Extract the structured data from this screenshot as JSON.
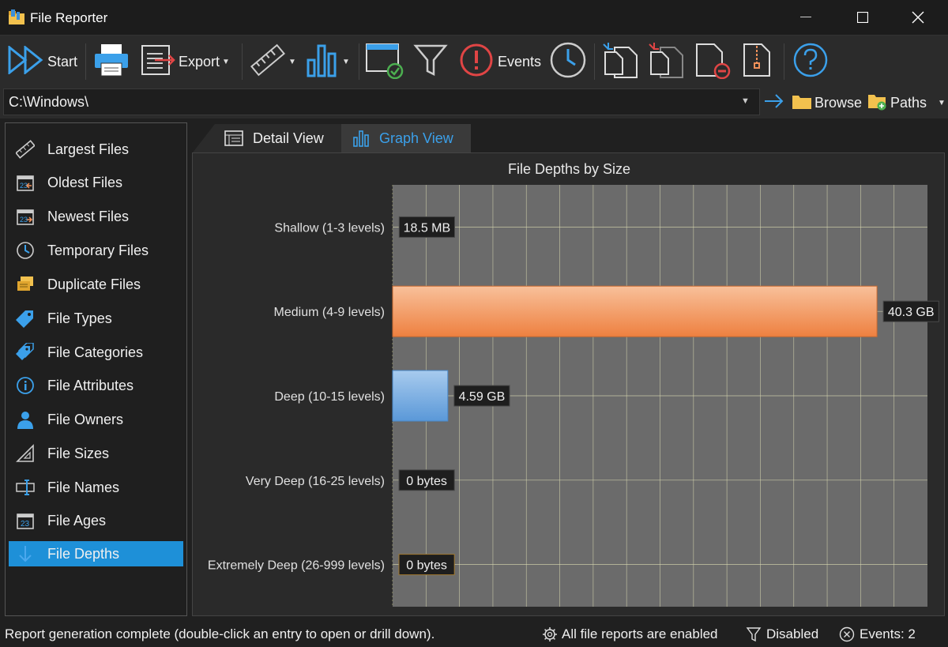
{
  "window": {
    "title": "File Reporter"
  },
  "toolbar": {
    "start_label": "Start",
    "export_label": "Export",
    "events_label": "Events"
  },
  "pathbar": {
    "path_value": "C:\\Windows\\",
    "browse_label": "Browse",
    "paths_label": "Paths"
  },
  "sidebar": {
    "items": [
      {
        "label": "Largest Files",
        "icon": "ruler-icon"
      },
      {
        "label": "Oldest Files",
        "icon": "calendar-old-icon"
      },
      {
        "label": "Newest Files",
        "icon": "calendar-new-icon"
      },
      {
        "label": "Temporary Files",
        "icon": "clock-icon"
      },
      {
        "label": "Duplicate Files",
        "icon": "duplicate-files-icon"
      },
      {
        "label": "File Types",
        "icon": "tag-icon"
      },
      {
        "label": "File Categories",
        "icon": "tags-icon"
      },
      {
        "label": "File Attributes",
        "icon": "info-icon"
      },
      {
        "label": "File Owners",
        "icon": "user-icon"
      },
      {
        "label": "File Sizes",
        "icon": "triangle-ruler-icon"
      },
      {
        "label": "File Names",
        "icon": "rename-icon"
      },
      {
        "label": "File Ages",
        "icon": "calendar-23-icon"
      },
      {
        "label": "File Depths",
        "icon": "arrow-down-icon"
      }
    ],
    "active_index": 12
  },
  "tabs": [
    {
      "label": "Detail View",
      "icon": "table-icon"
    },
    {
      "label": "Graph View",
      "icon": "bar-chart-icon"
    }
  ],
  "active_tab": 1,
  "colors": {
    "accent": "#1e90d8",
    "bar_orange": "#f0915a",
    "bar_blue": "#6fa8dc",
    "plot_bg": "#6b6b6b",
    "grid": "#d8d8b0"
  },
  "chart_data": {
    "type": "bar",
    "orientation": "horizontal",
    "title": "File Depths by Size",
    "categories": [
      "Shallow (1-3 levels)",
      "Medium (4-9 levels)",
      "Deep (10-15 levels)",
      "Very Deep (16-25 levels)",
      "Extremely Deep (26-999 levels)"
    ],
    "values_gb": [
      0.0185,
      40.3,
      4.59,
      0,
      0
    ],
    "value_labels": [
      "18.5 MB",
      "40.3 GB",
      "4.59 GB",
      "0 bytes",
      "0 bytes"
    ],
    "xlim_gb": [
      0,
      44.5
    ],
    "grid": true,
    "bar_styles": [
      "none",
      "orange",
      "blue",
      "none",
      "none"
    ]
  },
  "status": {
    "message": "Report generation complete (double-click an entry to open or drill down).",
    "reports_enabled": "All file reports are enabled",
    "filter_status": "Disabled",
    "events_count": "Events: 2"
  }
}
